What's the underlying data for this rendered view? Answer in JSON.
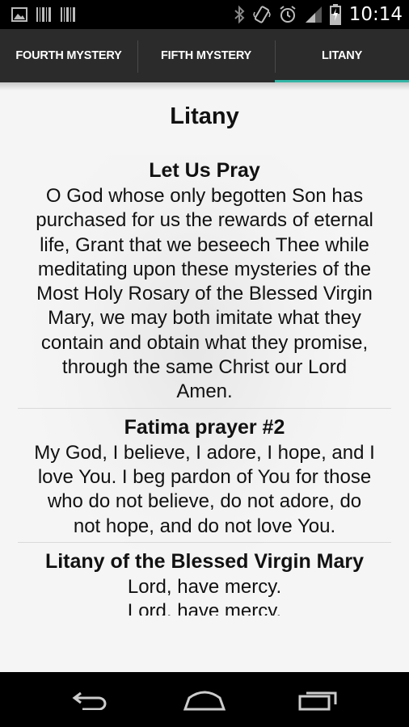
{
  "status_bar": {
    "time": "10:14",
    "left_icons": [
      "image-icon",
      "barcode-icon",
      "barcode-icon"
    ],
    "right_icons": [
      "bluetooth-icon",
      "vibrate-icon",
      "alarm-icon",
      "signal-icon",
      "battery-icon"
    ]
  },
  "tabs": [
    {
      "label": "FOURTH MYSTERY",
      "active": false
    },
    {
      "label": "FIFTH MYSTERY",
      "active": false
    },
    {
      "label": "LITANY",
      "active": true
    }
  ],
  "accent_color": "#33b5a5",
  "page": {
    "title": "Litany",
    "sections": [
      {
        "title": "Let Us Pray",
        "body": "O God whose only begotten Son has\npurchased for us the rewards of eternal\nlife, Grant that we beseech Thee while\nmeditating upon these mysteries of the\nMost Holy Rosary of the Blessed Virgin\nMary, we may both imitate what they\ncontain and obtain what they promise,\nthrough the same Christ our Lord\nAmen."
      },
      {
        "title": "Fatima prayer #2",
        "body": "My God, I believe, I adore, I hope, and I\nlove You. I beg pardon of You for those\nwho do not believe, do not adore, do\nnot hope, and do not love You."
      },
      {
        "title": "Litany of the Blessed Virgin Mary",
        "body": "Lord, have mercy.\nLord, have mercy."
      }
    ]
  },
  "nav_bar": {
    "buttons": [
      "back-icon",
      "home-icon",
      "recent-apps-icon"
    ]
  }
}
